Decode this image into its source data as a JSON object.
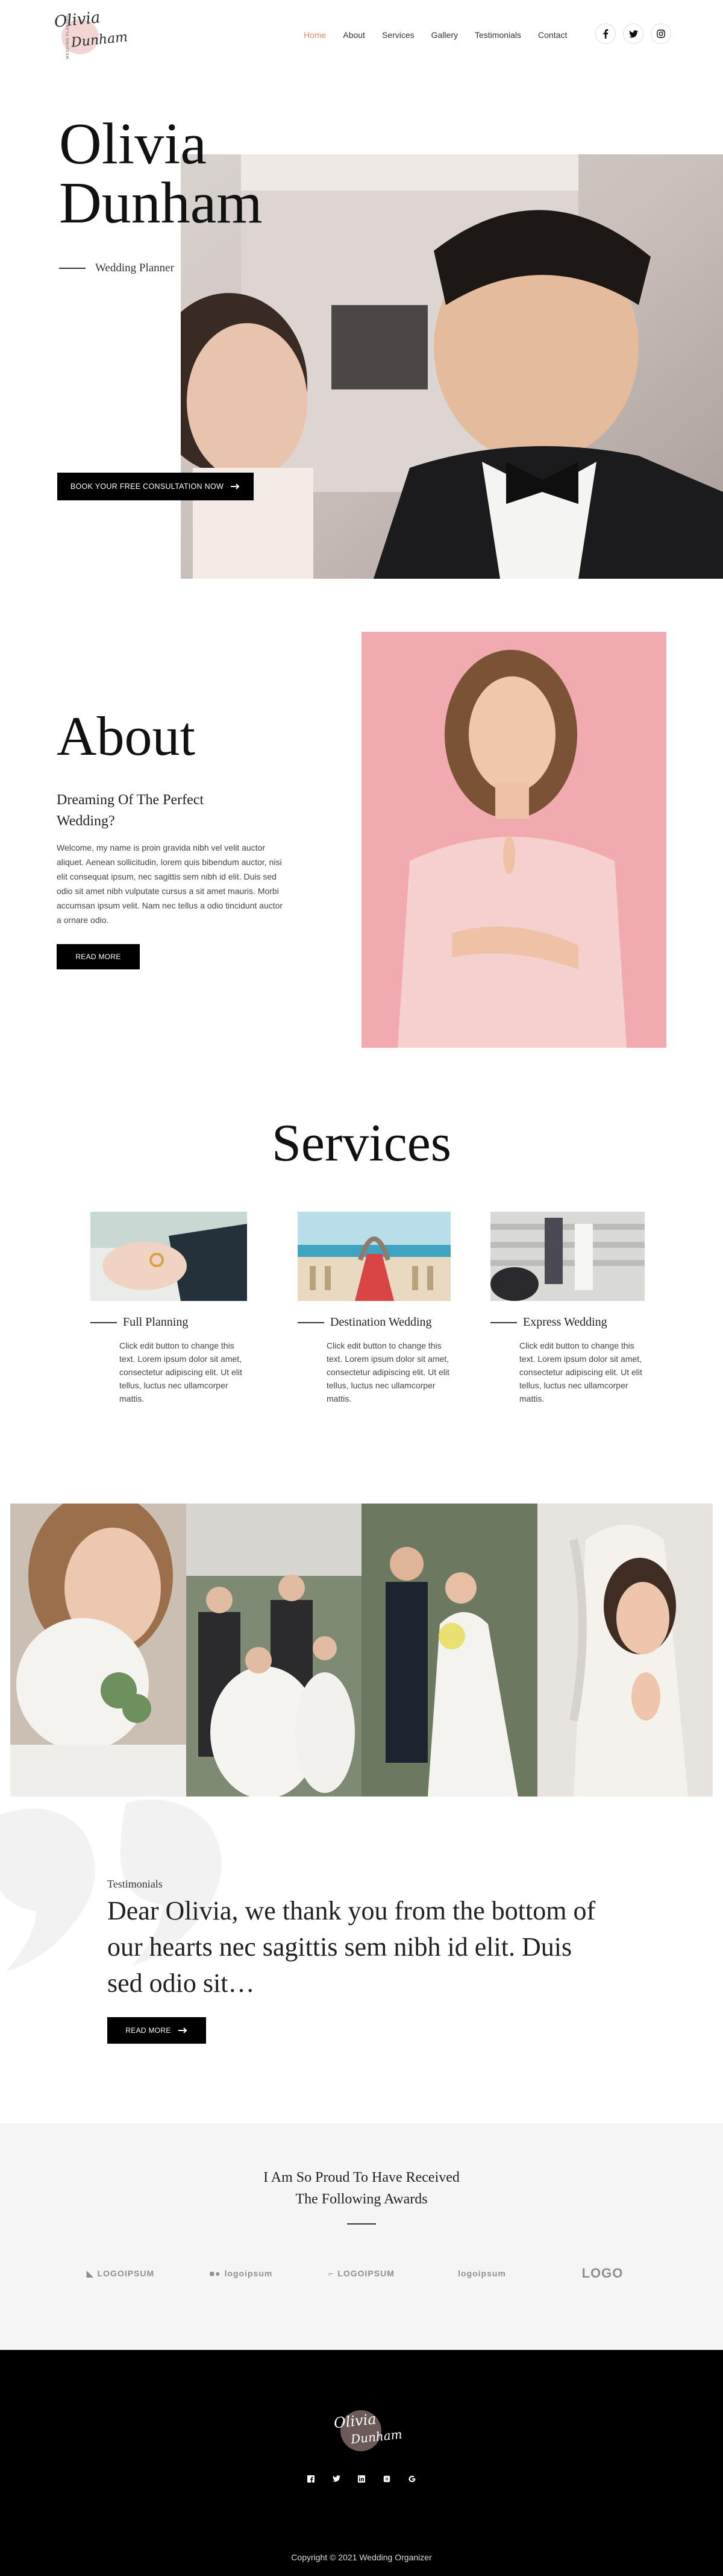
{
  "brand": {
    "logo_text_1": "Olivia",
    "logo_text_2": "Dunham",
    "logo_vertical": "WEDDING PLANNER"
  },
  "nav": {
    "items": [
      "Home",
      "About",
      "Services",
      "Gallery",
      "Testimonials",
      "Contact"
    ],
    "active": "Home"
  },
  "social": [
    "facebook-icon",
    "twitter-icon",
    "instagram-icon"
  ],
  "hero": {
    "title_line1": "Olivia",
    "title_line2": "Dunham",
    "subtitle": "Wedding Planner",
    "cta": "BOOK YOUR FREE CONSULTATION NOW"
  },
  "about": {
    "title": "About",
    "subtitle": "Dreaming Of The Perfect Wedding?",
    "text": "Welcome, my name is proin gravida nibh vel velit auctor aliquet. Aenean sollicitudin, lorem quis bibendum auctor, nisi elit consequat ipsum, nec sagittis sem nibh id elit. Duis sed odio sit amet nibh vulputate cursus a sit amet mauris. Morbi accumsan ipsum velit. Nam nec tellus a odio tincidunt auctor a ornare odio.",
    "button": "READ MORE"
  },
  "services": {
    "title": "Services",
    "items": [
      {
        "name": "Full Planning",
        "text": "Click edit button to change this text. Lorem ipsum dolor sit amet, consectetur adipiscing elit. Ut elit tellus, luctus nec ullamcorper mattis."
      },
      {
        "name": "Destination Wedding",
        "text": "Click edit button to change this text. Lorem ipsum dolor sit amet, consectetur adipiscing elit. Ut elit tellus, luctus nec ullamcorper mattis."
      },
      {
        "name": "Express Wedding",
        "text": "Click edit button to change this text. Lorem ipsum dolor sit amet, consectetur adipiscing elit. Ut elit tellus, luctus nec ullamcorper mattis."
      }
    ]
  },
  "testimonials": {
    "label": "Testimonials",
    "quote": "Dear Olivia, we thank you from the bottom of our hearts nec sagittis sem nibh id elit. Duis sed odio sit…",
    "button": "READ MORE"
  },
  "awards": {
    "title_line1": "I Am So Proud To Have Received",
    "title_line2": "The Following Awards",
    "logos": [
      "LOGOIPSUM",
      "logoipsum",
      "LOGOIPSUM",
      "logoipsum",
      "LOGO"
    ]
  },
  "footer": {
    "icons": [
      "facebook-icon",
      "twitter-icon",
      "linkedin-icon",
      "instagram-icon",
      "google-icon"
    ],
    "copyright": "Copyright © 2021 Wedding Organizer"
  }
}
